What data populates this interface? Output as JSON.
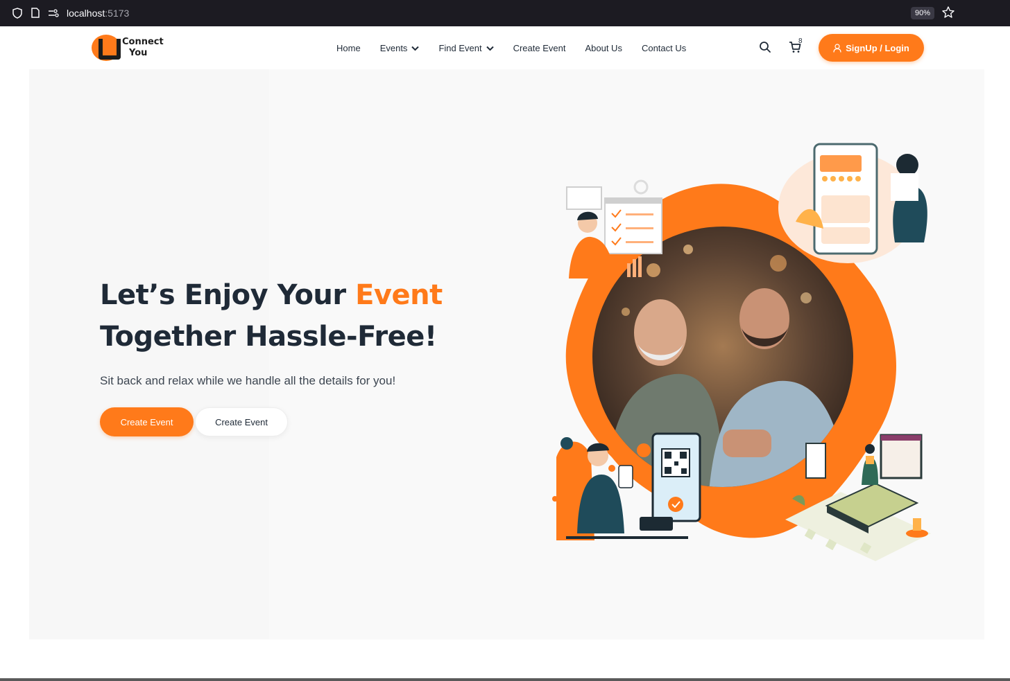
{
  "browser": {
    "url_host": "localhost",
    "url_port": ":5173",
    "zoom": "90%"
  },
  "header": {
    "logo_line1": "Connect",
    "logo_line2": "You",
    "nav": [
      {
        "label": "Home"
      },
      {
        "label": "Events"
      },
      {
        "label": "Find Event"
      },
      {
        "label": "Create Event"
      },
      {
        "label": "About Us"
      },
      {
        "label": "Contact Us"
      }
    ],
    "cart_count": "8",
    "signup_label": "SignUp / Login"
  },
  "hero": {
    "headline_part1": "Let’s Enjoy Your ",
    "headline_accent": "Event",
    "headline_line2": "Together Hassle-Free!",
    "subtitle": "Sit back and relax while we handle all the details for you!",
    "primary_button": "Create Event",
    "secondary_button": "Create Event"
  },
  "colors": {
    "accent": "#ff7a1a",
    "dark": "#1f2a37",
    "teal": "#1f4b5a"
  }
}
